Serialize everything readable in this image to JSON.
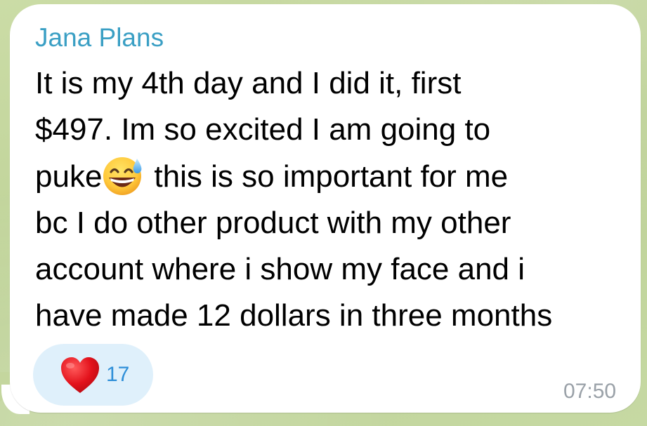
{
  "message": {
    "sender": "Jana Plans",
    "lines": [
      "It is my 4th day and I  did it, first",
      "$497. Im so excited I am going to",
      "puke",
      "this is so important for me",
      "bc I do other product with my other",
      "account where i show my face and i",
      "have made 12 dollars in three months"
    ],
    "emoji": "grinning-face-with-sweat-icon",
    "time": "07:50"
  },
  "reaction": {
    "icon": "red-heart-icon",
    "count": "17"
  },
  "colors": {
    "sender_name": "#3a9fc4",
    "reaction_pill": "#dff0fb",
    "reaction_count": "#2f8fd8",
    "timestamp": "#9aa1a8",
    "chat_background": "#c5d7a0"
  }
}
